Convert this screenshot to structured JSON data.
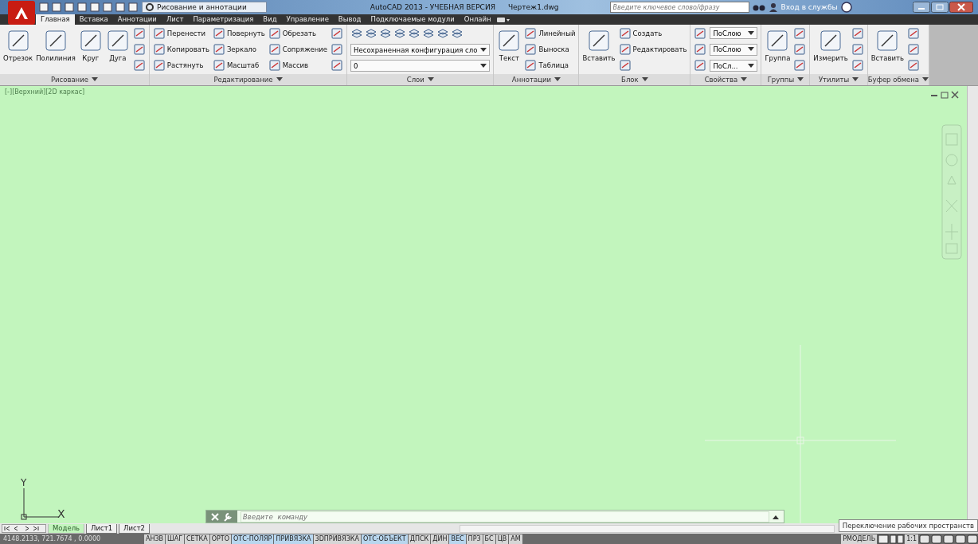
{
  "title_bar": {
    "workspace": "Рисование и аннотации",
    "title": "AutoCAD 2013 - УЧЕБНАЯ ВЕРСИЯ",
    "file": "Чертеж1.dwg",
    "search": {
      "placeholder": "Введите ключевое слово/фразу"
    },
    "sign_in": "Вход в службы"
  },
  "ribbon_tabs": [
    {
      "label": "Главная",
      "selected": true
    },
    {
      "label": "Вставка",
      "selected": false
    },
    {
      "label": "Аннотации",
      "selected": false
    },
    {
      "label": "Лист",
      "selected": false
    },
    {
      "label": "Параметризация",
      "selected": false
    },
    {
      "label": "Вид",
      "selected": false
    },
    {
      "label": "Управление",
      "selected": false
    },
    {
      "label": "Вывод",
      "selected": false
    },
    {
      "label": "Подключаемые модули",
      "selected": false
    },
    {
      "label": "Онлайн",
      "selected": false
    }
  ],
  "panels": [
    {
      "title": "Рисование",
      "columns": [
        [
          {
            "kind": "large",
            "label": "Отрезок"
          }
        ],
        [
          {
            "kind": "large",
            "label": "Полилиния"
          }
        ],
        [
          {
            "kind": "large",
            "label": "Круг"
          }
        ],
        [
          {
            "kind": "large",
            "label": "Дуга"
          }
        ],
        [
          {
            "kind": "icon"
          },
          {
            "kind": "icon"
          },
          {
            "kind": "icon"
          }
        ]
      ]
    },
    {
      "title": "Редактирование",
      "columns": [
        [
          {
            "kind": "small",
            "label": "Перенести"
          },
          {
            "kind": "small",
            "label": "Копировать"
          },
          {
            "kind": "small",
            "label": "Растянуть"
          }
        ],
        [
          {
            "kind": "small",
            "label": "Повернуть"
          },
          {
            "kind": "small",
            "label": "Зеркало"
          },
          {
            "kind": "small",
            "label": "Масштаб"
          }
        ],
        [
          {
            "kind": "small",
            "label": "Обрезать"
          },
          {
            "kind": "small",
            "label": "Сопряжение"
          },
          {
            "kind": "small",
            "label": "Массив"
          }
        ],
        [
          {
            "kind": "icon"
          },
          {
            "kind": "icon"
          },
          {
            "kind": "icon"
          }
        ]
      ]
    },
    {
      "title": "Слои",
      "columns": [
        [
          {
            "kind": "iconrow"
          },
          {
            "kind": "combo",
            "label": "Несохраненная конфигурация сло"
          },
          {
            "kind": "combo",
            "label": "0"
          }
        ]
      ]
    },
    {
      "title": "Аннотации",
      "columns": [
        [
          {
            "kind": "large",
            "label": "Текст"
          }
        ],
        [
          {
            "kind": "small",
            "label": "Линейный"
          },
          {
            "kind": "small",
            "label": "Выноска"
          },
          {
            "kind": "small",
            "label": "Таблица"
          }
        ]
      ]
    },
    {
      "title": "Блок",
      "columns": [
        [
          {
            "kind": "large",
            "label": "Вставить"
          }
        ],
        [
          {
            "kind": "small",
            "label": "Создать"
          },
          {
            "kind": "small",
            "label": "Редактировать"
          },
          {
            "kind": "icon"
          }
        ]
      ]
    },
    {
      "title": "Свойства",
      "columns": [
        [
          {
            "kind": "icon"
          },
          {
            "kind": "icon"
          },
          {
            "kind": "icon"
          }
        ],
        [
          {
            "kind": "combo",
            "label": "ПоСлою"
          },
          {
            "kind": "combo",
            "label": "ПоСлою"
          },
          {
            "kind": "combo",
            "label": "ПоСл..."
          }
        ]
      ]
    },
    {
      "title": "Группы",
      "columns": [
        [
          {
            "kind": "large",
            "label": "Группа"
          }
        ],
        [
          {
            "kind": "icon"
          },
          {
            "kind": "icon"
          },
          {
            "kind": "icon"
          }
        ]
      ]
    },
    {
      "title": "Утилиты",
      "columns": [
        [
          {
            "kind": "large",
            "label": "Измерить"
          }
        ],
        [
          {
            "kind": "icon"
          },
          {
            "kind": "icon"
          },
          {
            "kind": "icon"
          }
        ]
      ]
    },
    {
      "title": "Буфер обмена",
      "columns": [
        [
          {
            "kind": "large",
            "label": "Вставить"
          }
        ],
        [
          {
            "kind": "icon"
          },
          {
            "kind": "icon"
          },
          {
            "kind": "icon"
          }
        ]
      ]
    }
  ],
  "viewport": {
    "label": "[-][Верхний][2D каркас]",
    "ucs": {
      "y": "Y",
      "x": "X"
    },
    "command": {
      "placeholder": "Введите команду"
    }
  },
  "layout_tabs": [
    {
      "label": "Модель",
      "selected": true
    },
    {
      "label": "Лист1",
      "selected": false
    },
    {
      "label": "Лист2",
      "selected": false
    }
  ],
  "status_bar": {
    "coordinates": "4148.2133, 721.7674 , 0.0000",
    "toggles": [
      {
        "label": "АНЗВ",
        "on": false
      },
      {
        "label": "ШАГ",
        "on": false
      },
      {
        "label": "СЕТКА",
        "on": false
      },
      {
        "label": "ОРТО",
        "on": false
      },
      {
        "label": "ОТС-ПОЛЯР",
        "on": true
      },
      {
        "label": "ПРИВЯЗКА",
        "on": true
      },
      {
        "label": "3DПРИВЯЗКА",
        "on": false
      },
      {
        "label": "ОТС-ОБЪЕКТ",
        "on": true
      },
      {
        "label": "ДПСК",
        "on": false
      },
      {
        "label": "ДИН",
        "on": false
      },
      {
        "label": "ВЕС",
        "on": true
      },
      {
        "label": "ПРЗ",
        "on": false
      },
      {
        "label": "БС",
        "on": false
      },
      {
        "label": "ЦВ",
        "on": false
      },
      {
        "label": "АМ",
        "on": false
      }
    ],
    "model": "РМОДЕЛЬ",
    "scale": "1:1",
    "tooltip": "Переключение рабочих пространств"
  }
}
